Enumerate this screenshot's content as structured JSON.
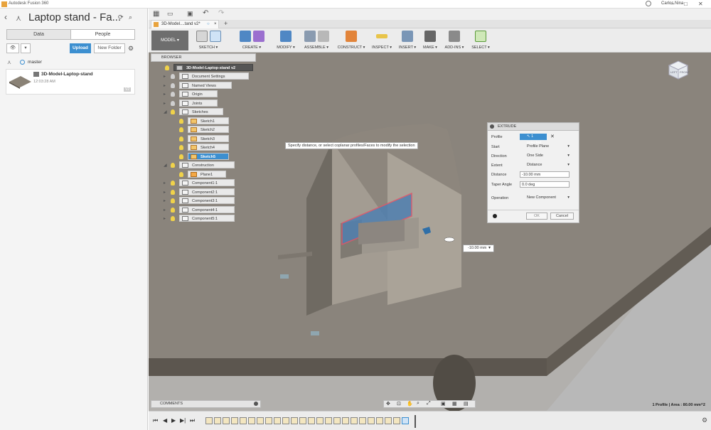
{
  "app": {
    "title": "Autodesk Fusion 360"
  },
  "window": {
    "user": "Carlos Nina"
  },
  "left_panel": {
    "project_title": "Laptop stand - Fa...",
    "tabs": [
      "Data",
      "People"
    ],
    "upload_label": "Upload",
    "new_folder_label": "New Folder",
    "branch": "master",
    "file": {
      "name": "3D-Model-Laptop-stand",
      "time": "12:03:28 AM",
      "version": "V2"
    }
  },
  "document_tab": {
    "label": "3D-Model....tand v2*"
  },
  "ribbon": {
    "model_label": "MODEL",
    "groups": [
      "SKETCH",
      "CREATE",
      "MODIFY",
      "ASSEMBLE",
      "CONSTRUCT",
      "INSPECT",
      "INSERT",
      "MAKE",
      "ADD-INS",
      "SELECT"
    ]
  },
  "browser": {
    "title": "BROWSER",
    "root": "3D-Model-Laptop-stand v2",
    "items": [
      {
        "label": "Document Settings",
        "indent": 0
      },
      {
        "label": "Named Views",
        "indent": 0
      },
      {
        "label": "Origin",
        "indent": 0
      },
      {
        "label": "Joints",
        "indent": 0
      },
      {
        "label": "Sketches",
        "indent": 0
      },
      {
        "label": "Sketch1",
        "indent": 1
      },
      {
        "label": "Sketch2",
        "indent": 1
      },
      {
        "label": "Sketch3",
        "indent": 1
      },
      {
        "label": "Sketch4",
        "indent": 1
      },
      {
        "label": "Sketch5",
        "indent": 1
      },
      {
        "label": "Construction",
        "indent": 0
      },
      {
        "label": "Plane1",
        "indent": 1
      },
      {
        "label": "Component1:1",
        "indent": 0
      },
      {
        "label": "Component2:1",
        "indent": 0
      },
      {
        "label": "Component3:1",
        "indent": 0
      },
      {
        "label": "Component4:1",
        "indent": 0
      },
      {
        "label": "Component5:1",
        "indent": 0
      }
    ]
  },
  "tooltip": "Specify distance, or select coplanar profiles/Faces to modify the selection",
  "extrude": {
    "title": "EXTRUDE",
    "fields": [
      {
        "label": "Profile",
        "value": "1 selected"
      },
      {
        "label": "Start",
        "value": "Profile Plane"
      },
      {
        "label": "Direction",
        "value": "One Side"
      },
      {
        "label": "Extent",
        "value": "Distance"
      },
      {
        "label": "Distance",
        "value": "-10.00 mm"
      },
      {
        "label": "Taper Angle",
        "value": "0.0 deg"
      },
      {
        "label": "Operation",
        "value": "New Component"
      }
    ],
    "ok_label": "OK",
    "cancel_label": "Cancel"
  },
  "distance_input": "-10.00 mm",
  "viewcube": {
    "left": "LEFT",
    "front": "FRONT"
  },
  "comments_label": "COMMENTS",
  "status_text": "1 Profile | Area : 80.00 mm^2",
  "colors": {
    "accent": "#3c8fd0",
    "model_button": "#6e6e6e",
    "profile_highlight": "#4f7fb0",
    "profile_outline": "#e0556a"
  }
}
